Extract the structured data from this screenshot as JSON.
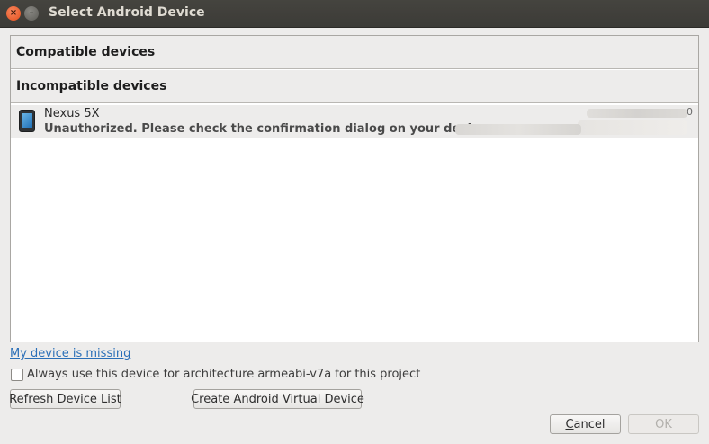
{
  "window": {
    "title": "Select Android Device",
    "close_glyph": "×",
    "minimize_glyph": "–"
  },
  "groups": {
    "compatible_label": "Compatible devices",
    "incompatible_label": "Incompatible devices"
  },
  "devices": [
    {
      "name": "Nexus 5X",
      "status": "Unauthorized. Please check the confirmation dialog on your device",
      "icon": "phone-icon"
    }
  ],
  "links": {
    "missing": "My device is missing"
  },
  "options": {
    "always_use_label": "Always use this device for architecture armeabi-v7a for this project",
    "always_use_checked": false
  },
  "buttons": {
    "refresh": "Refresh Device List",
    "create_avd": "Create Android Virtual Device",
    "cancel_mnemonic": "C",
    "cancel_rest": "ancel",
    "ok": "OK"
  }
}
